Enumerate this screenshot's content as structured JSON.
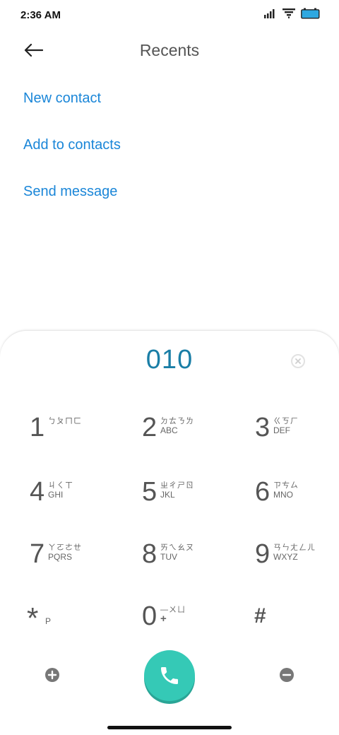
{
  "status_bar": {
    "time": "2:36 AM",
    "icons": [
      "signal-icon",
      "wifi-icon",
      "battery-icon"
    ],
    "battery_color": "#2fa8e0"
  },
  "header": {
    "title": "Recents",
    "back_icon": "back-arrow-icon"
  },
  "actions": [
    {
      "label": "New contact"
    },
    {
      "label": "Add to contacts"
    },
    {
      "label": "Send message"
    }
  ],
  "dialer": {
    "number": "010",
    "clear_icon": "clear-icon",
    "keys": [
      {
        "digit": "1",
        "zhuyin": "ㄅㄆㄇㄈ",
        "letters": ""
      },
      {
        "digit": "2",
        "zhuyin": "ㄉㄊㄋㄌ",
        "letters": "ABC"
      },
      {
        "digit": "3",
        "zhuyin": "ㄍㄎㄏ",
        "letters": "DEF"
      },
      {
        "digit": "4",
        "zhuyin": "ㄐㄑㄒ",
        "letters": "GHI"
      },
      {
        "digit": "5",
        "zhuyin": "ㄓㄔㄕㄖ",
        "letters": "JKL"
      },
      {
        "digit": "6",
        "zhuyin": "ㄗㄘㄙ",
        "letters": "MNO"
      },
      {
        "digit": "7",
        "zhuyin": "ㄚㄛㄜㄝ",
        "letters": "PQRS"
      },
      {
        "digit": "8",
        "zhuyin": "ㄞㄟㄠㄡ",
        "letters": "TUV"
      },
      {
        "digit": "9",
        "zhuyin": "ㄢㄣㄤㄥㄦ",
        "letters": "WXYZ"
      },
      {
        "digit": "*",
        "zhuyin": "",
        "letters": "P"
      },
      {
        "digit": "0",
        "zhuyin": "—ㄨㄩ",
        "letters": "+"
      },
      {
        "digit": "#",
        "zhuyin": "",
        "letters": ""
      }
    ],
    "call_icon": "phone-icon",
    "accent_color": "#35c9b6",
    "number_color": "#1a7ea6"
  },
  "link_color": "#1a86d8"
}
